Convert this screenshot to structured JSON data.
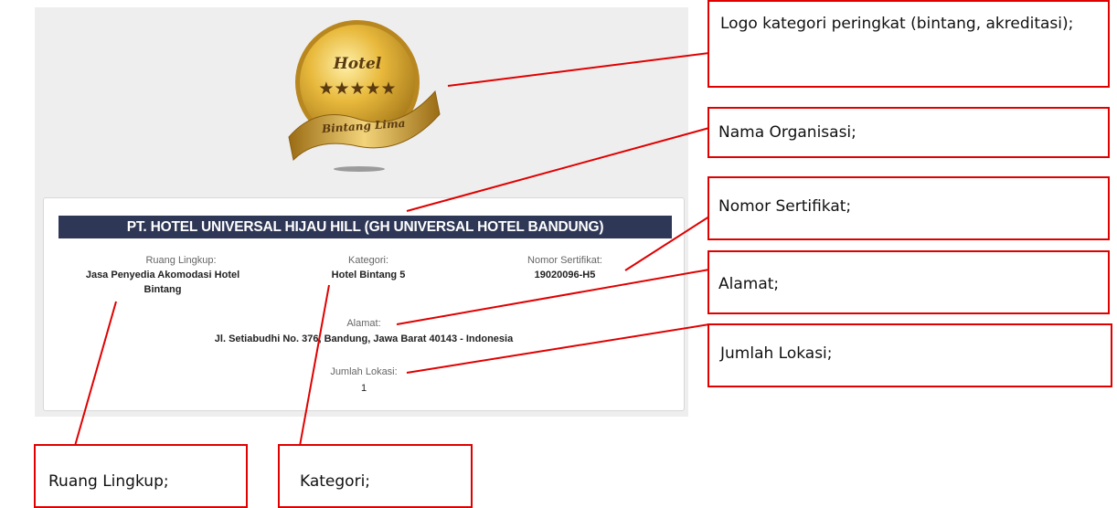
{
  "medal": {
    "title": "Hotel",
    "stars": "★★★★★",
    "ribbon_text": "Bintang Lima",
    "colors": {
      "gold": "#d9a829",
      "gold_dark": "#a5781a",
      "text": "#5a3a10"
    }
  },
  "certificate": {
    "organization_name": "PT. HOTEL UNIVERSAL HIJAU HILL (GH UNIVERSAL HOTEL BANDUNG)",
    "scope_label": "Ruang Lingkup:",
    "scope_value": "Jasa Penyedia Akomodasi Hotel Bintang",
    "category_label": "Kategori:",
    "category_value": "Hotel Bintang 5",
    "certificate_number_label": "Nomor Sertifikat:",
    "certificate_number_value": "19020096-H5",
    "address_label": "Alamat:",
    "address_value": "Jl. Setiabudhi No. 376, Bandung, Jawa Barat 40143 - Indonesia",
    "location_count_label": "Jumlah Lokasi:",
    "location_count_value": "1",
    "colors": {
      "header_bar": "#2e3756",
      "panel_bg": "#eeeeee"
    }
  },
  "annotations": {
    "logo": "Logo kategori peringkat (bintang, akreditasi);",
    "organization": "Nama Organisasi;",
    "certificate_number": "Nomor  Sertifikat;",
    "address": "Alamat;",
    "location_count": "Jumlah Lokasi;",
    "scope": "Ruang Lingkup;",
    "category": "Kategori;",
    "colors": {
      "border": "#e00000",
      "leader_line": "#e00000"
    }
  }
}
